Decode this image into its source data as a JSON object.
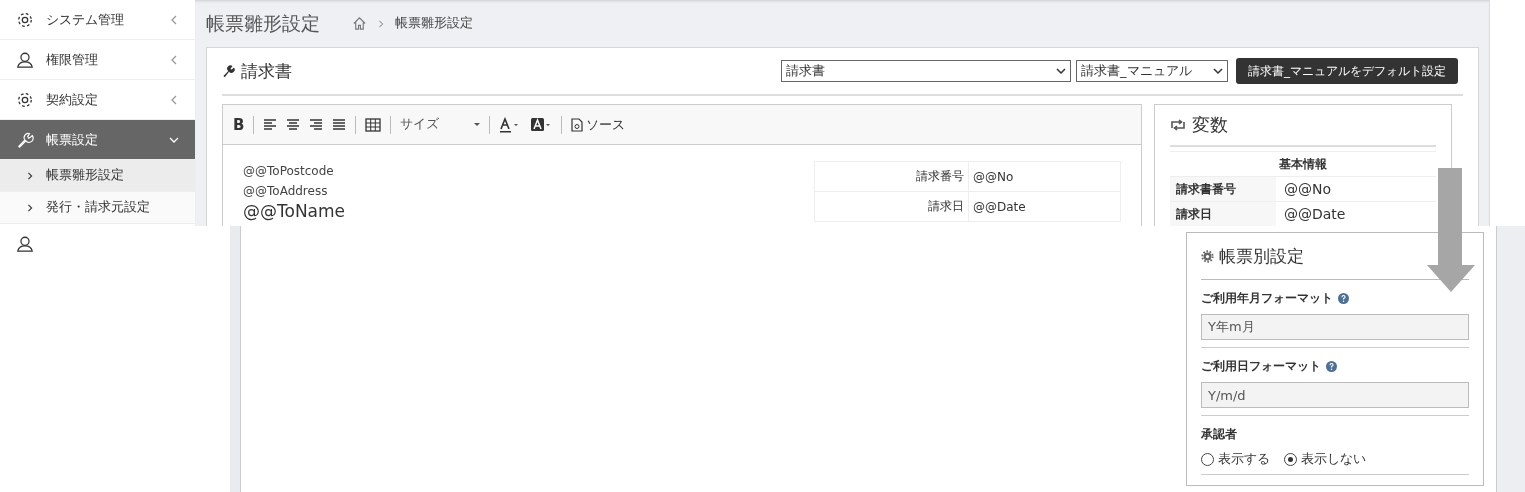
{
  "sidebar": {
    "items": [
      {
        "label": "システム管理",
        "expanded": false,
        "selected": false
      },
      {
        "label": "権限管理",
        "expanded": false,
        "selected": false
      },
      {
        "label": "契約設定",
        "expanded": false,
        "selected": false
      },
      {
        "label": "帳票設定",
        "expanded": true,
        "selected": true,
        "children": [
          {
            "label": "帳票雛形設定",
            "selected": true
          },
          {
            "label": "発行・請求元設定",
            "selected": false
          }
        ]
      }
    ]
  },
  "page": {
    "title": "帳票雛形設定",
    "breadcrumb": [
      "帳票雛形設定"
    ]
  },
  "card": {
    "title": "請求書",
    "template_select": {
      "value": "請求書"
    },
    "variant_select": {
      "value": "請求書_マニュアル"
    },
    "default_button": "請求書_マニュアルをデフォルト設定"
  },
  "editor": {
    "toolbar": {
      "bold": "B",
      "size_label": "サイズ",
      "source_label": "ソース"
    },
    "lines": [
      "@@ToPostcode",
      "@@ToAddress"
    ],
    "name_line": "@@ToName",
    "info_rows": [
      {
        "label": "請求番号",
        "value": "@@No"
      },
      {
        "label": "請求日",
        "value": "@@Date"
      }
    ]
  },
  "variables": {
    "title": "変数",
    "section": "基本情報",
    "rows": [
      {
        "label": "請求書番号",
        "value": "@@No"
      },
      {
        "label": "請求日",
        "value": "@@Date"
      }
    ]
  },
  "settings": {
    "title": "帳票別設定",
    "fields": [
      {
        "label": "ご利用年月フォーマット",
        "value": "Y年m月"
      },
      {
        "label": "ご利用日フォーマット",
        "value": "Y/m/d"
      }
    ],
    "approver": {
      "label": "承認者",
      "options": [
        {
          "label": "表示する",
          "selected": false
        },
        {
          "label": "表示しない",
          "selected": true
        }
      ]
    }
  }
}
